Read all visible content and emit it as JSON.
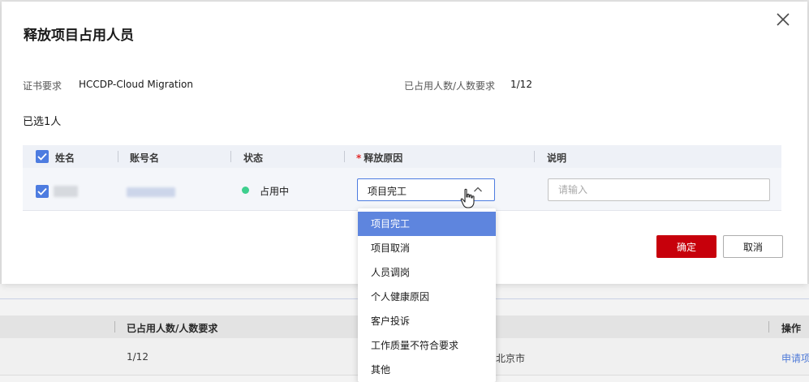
{
  "dialog": {
    "title": "释放项目占用人员",
    "cert_label": "证书要求",
    "cert_value": "HCCDP-Cloud Migration",
    "occupied_label": "已占用人数/人数要求",
    "occupied_value": "1/12",
    "selected_count": "已选1人"
  },
  "table": {
    "headers": {
      "name": "姓名",
      "account": "账号名",
      "status": "状态",
      "reason": "释放原因",
      "note": "说明"
    },
    "row": {
      "status_text": "占用中",
      "status_color": "#3ecf8e",
      "reason_value": "项目完工",
      "note_placeholder": "请输入"
    }
  },
  "dropdown": {
    "options": [
      "项目完工",
      "项目取消",
      "人员调岗",
      "个人健康原因",
      "客户投诉",
      "工作质量不符合要求",
      "其他"
    ],
    "selected_index": 0
  },
  "buttons": {
    "confirm": "确定",
    "cancel": "取消"
  },
  "background": {
    "header_occupied": "已占用人数/人数要求",
    "header_action": "操作",
    "row_occupied": "1/12",
    "row_city": "北京市",
    "row_action": "申请项"
  },
  "colors": {
    "primary_blue": "#4d7ce0",
    "confirm_red": "#c7000b",
    "dropdown_active": "#5e85de"
  }
}
